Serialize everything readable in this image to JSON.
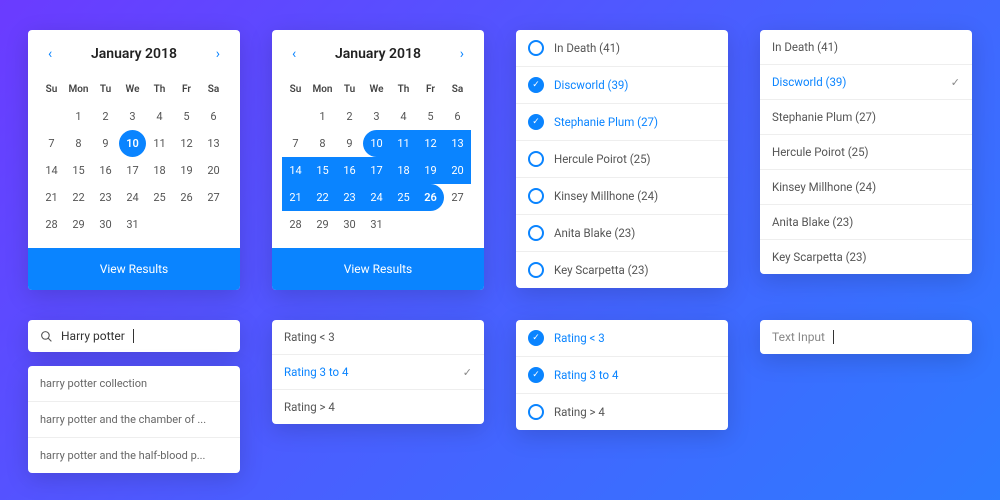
{
  "calendar": {
    "title": "January 2018",
    "dow": [
      "Su",
      "Mon",
      "Tu",
      "We",
      "Th",
      "Fr",
      "Sa"
    ],
    "weeks": [
      [
        "",
        1,
        2,
        3,
        4,
        5,
        6
      ],
      [
        7,
        8,
        9,
        10,
        11,
        12,
        13
      ],
      [
        14,
        15,
        16,
        17,
        18,
        19,
        20
      ],
      [
        21,
        22,
        23,
        24,
        25,
        26,
        27
      ],
      [
        28,
        29,
        30,
        31,
        "",
        "",
        ""
      ]
    ],
    "single_selected": 10,
    "range": {
      "start": 10,
      "end": 26
    },
    "footer": "View Results"
  },
  "series_list": {
    "items": [
      {
        "label": "In Death (41)"
      },
      {
        "label": "Discworld (39)"
      },
      {
        "label": "Stephanie Plum (27)"
      },
      {
        "label": "Hercule Poirot (25)"
      },
      {
        "label": "Kinsey Millhone (24)"
      },
      {
        "label": "Anita Blake (23)"
      },
      {
        "label": "Key Scarpetta (23)"
      }
    ],
    "multi_selected": [
      1,
      2
    ],
    "single_selected": 1
  },
  "search": {
    "value": "Harry potter",
    "suggestions": [
      "harry potter collection",
      "harry potter and the chamber of ...",
      "harry potter and the half-blood p..."
    ]
  },
  "ratings": {
    "items": [
      "Rating < 3",
      "Rating 3 to 4",
      "Rating > 4"
    ],
    "single_selected": 1,
    "multi_selected": [
      0,
      1
    ]
  },
  "text_input": {
    "placeholder": "Text Input"
  }
}
